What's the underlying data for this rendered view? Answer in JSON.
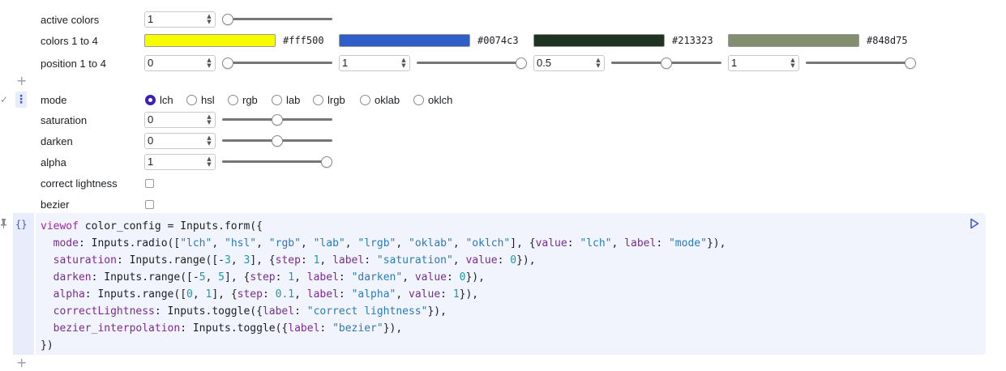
{
  "active_colors": {
    "label": "active colors",
    "value": "1",
    "slider_fraction": 0.0
  },
  "colors": {
    "label": "colors 1 to 4",
    "items": [
      {
        "color": "#fff500",
        "hex": "#fff500"
      },
      {
        "color": "#0074c3",
        "hex": "#0074c3"
      },
      {
        "color": "#213323",
        "hex": "#213323"
      },
      {
        "color": "#848d75",
        "hex": "#848d75"
      }
    ],
    "swatch_display": [
      "#f7fb00",
      "#2f5ec8",
      "#1f3323",
      "#838e71"
    ]
  },
  "positions": {
    "label": "position 1 to 4",
    "items": [
      {
        "value": "0",
        "fraction": 0.0
      },
      {
        "value": "1",
        "fraction": 1.0
      },
      {
        "value": "0.5",
        "fraction": 0.5
      },
      {
        "value": "1",
        "fraction": 1.0
      }
    ]
  },
  "mode": {
    "label": "mode",
    "options": [
      "lch",
      "hsl",
      "rgb",
      "lab",
      "lrgb",
      "oklab",
      "oklch"
    ],
    "selected": "lch"
  },
  "saturation": {
    "label": "saturation",
    "value": "0",
    "fraction": 0.5
  },
  "darken": {
    "label": "darken",
    "value": "0",
    "fraction": 0.5
  },
  "alpha": {
    "label": "alpha",
    "value": "1",
    "fraction": 1.0
  },
  "correct_lightness": {
    "label": "correct lightness",
    "checked": false
  },
  "bezier": {
    "label": "bezier",
    "checked": false
  },
  "icons": {
    "add_cell": "+",
    "cell_menu": "⋮",
    "check": "✓",
    "pin": "📌",
    "braces": "{}",
    "run": "▷"
  },
  "code": {
    "lines": [
      "viewof color_config = Inputs.form({",
      "  mode: Inputs.radio([\"lch\", \"hsl\", \"rgb\", \"lab\", \"lrgb\", \"oklab\", \"oklch\"], {value: \"lch\", label: \"mode\"}),",
      "  saturation: Inputs.range([-3, 3], {step: 1, label: \"saturation\", value: 0}),",
      "  darken: Inputs.range([-5, 5], {step: 1, label: \"darken\", value: 0}),",
      "  alpha: Inputs.range([0, 1], {step: 0.1, label: \"alpha\", value: 1}),",
      "  correctLightness: Inputs.toggle({label: \"correct lightness\"}),",
      "  bezier_interpolation: Inputs.toggle({label: \"bezier\"}),",
      "})"
    ]
  },
  "accent_color": "#3c1fb8"
}
